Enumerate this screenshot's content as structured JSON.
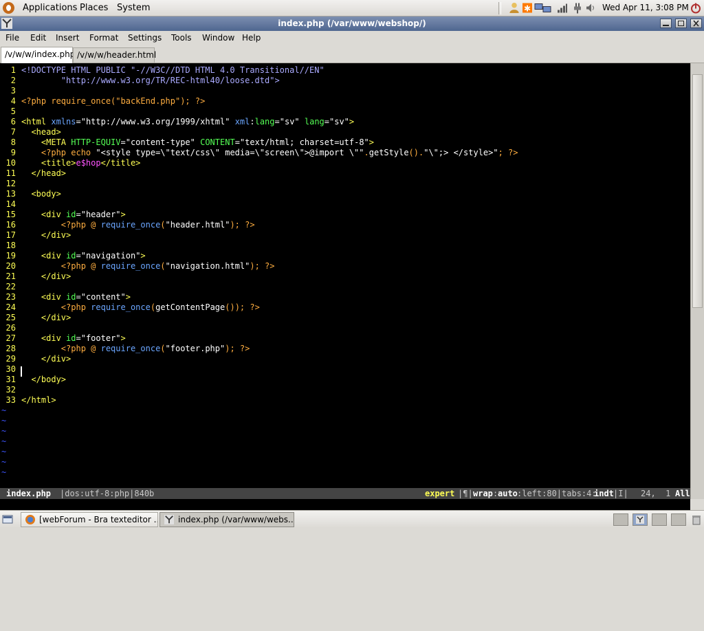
{
  "top_panel": {
    "menus": [
      "Applications",
      "Places",
      "System"
    ],
    "clock": "Wed Apr 11,  3:08 PM"
  },
  "window": {
    "title": "index.php (/var/www/webshop/)"
  },
  "menubar": [
    "File",
    "Edit",
    "Insert",
    "Format",
    "Settings",
    "Tools",
    "Window",
    "Help"
  ],
  "tabs": [
    {
      "label": "/v/w/w/index.php",
      "active": true
    },
    {
      "label": "/v/w/w/header.html",
      "active": false
    }
  ],
  "code_lines": [
    {
      "n": "1",
      "segs": [
        [
          "c-doc",
          "<!DOCTYPE HTML PUBLIC \"-//W3C//DTD HTML 4.0 Transitional//EN\""
        ]
      ]
    },
    {
      "n": "2",
      "segs": [
        [
          "c-doc",
          "        \"http://www.w3.org/TR/REC-html40/loose.dtd\">"
        ]
      ]
    },
    {
      "n": "3",
      "segs": []
    },
    {
      "n": "4",
      "segs": [
        [
          "c-php",
          "<?php require_once(\"backEnd.php\"); ?>"
        ]
      ]
    },
    {
      "n": "5",
      "segs": []
    },
    {
      "n": "6",
      "segs": [
        [
          "c-tag",
          "<html "
        ],
        [
          "c-fn",
          "xmlns"
        ],
        [
          "c-plain",
          "="
        ],
        [
          "c-str",
          "\"http://www.w3.org/1999/xhtml\" "
        ],
        [
          "c-fn",
          "xml"
        ],
        [
          "c-plain",
          ":"
        ],
        [
          "c-attr",
          "lang"
        ],
        [
          "c-plain",
          "="
        ],
        [
          "c-str",
          "\"sv\" "
        ],
        [
          "c-attr",
          "lang"
        ],
        [
          "c-plain",
          "="
        ],
        [
          "c-str",
          "\"sv\""
        ],
        [
          "c-tag",
          ">"
        ]
      ]
    },
    {
      "n": "7",
      "segs": [
        [
          "c-tag",
          "  <head>"
        ]
      ]
    },
    {
      "n": "8",
      "segs": [
        [
          "c-tag",
          "    <META "
        ],
        [
          "c-attr",
          "HTTP-EQUIV"
        ],
        [
          "c-plain",
          "="
        ],
        [
          "c-str",
          "\"content-type\" "
        ],
        [
          "c-attr",
          "CONTENT"
        ],
        [
          "c-plain",
          "="
        ],
        [
          "c-str",
          "\"text/html; charset=utf-8\""
        ],
        [
          "c-tag",
          ">"
        ]
      ]
    },
    {
      "n": "9",
      "segs": [
        [
          "c-php",
          "    <?php echo "
        ],
        [
          "c-str",
          "\"<style type=\\\"text/css\\\" media=\\\"screen\\\">@import \\\"\""
        ],
        [
          "c-php",
          "."
        ],
        [
          "c-str",
          "getStyle"
        ],
        [
          "c-php",
          "()."
        ],
        [
          "c-str",
          "\"\\\";> </style>\""
        ],
        [
          "c-php",
          "; ?>"
        ]
      ]
    },
    {
      "n": "10",
      "segs": [
        [
          "c-tag",
          "    <title>"
        ],
        [
          "c-mag",
          "e$hop"
        ],
        [
          "c-tag",
          "</title>"
        ]
      ]
    },
    {
      "n": "11",
      "segs": [
        [
          "c-tag",
          "  </head>"
        ]
      ]
    },
    {
      "n": "12",
      "segs": []
    },
    {
      "n": "13",
      "segs": [
        [
          "c-tag",
          "  <body>"
        ]
      ]
    },
    {
      "n": "14",
      "segs": []
    },
    {
      "n": "15",
      "segs": [
        [
          "c-tag",
          "    <div "
        ],
        [
          "c-attr",
          "id"
        ],
        [
          "c-plain",
          "="
        ],
        [
          "c-str",
          "\"header\""
        ],
        [
          "c-tag",
          ">"
        ]
      ]
    },
    {
      "n": "16",
      "segs": [
        [
          "c-php",
          "        <?php @ "
        ],
        [
          "c-fn",
          "require_once"
        ],
        [
          "c-php",
          "("
        ],
        [
          "c-str",
          "\"header.html\""
        ],
        [
          "c-php",
          "); ?>"
        ]
      ]
    },
    {
      "n": "17",
      "segs": [
        [
          "c-tag",
          "    </div>"
        ]
      ]
    },
    {
      "n": "18",
      "segs": []
    },
    {
      "n": "19",
      "segs": [
        [
          "c-tag",
          "    <div "
        ],
        [
          "c-attr",
          "id"
        ],
        [
          "c-plain",
          "="
        ],
        [
          "c-str",
          "\"navigation\""
        ],
        [
          "c-tag",
          ">"
        ]
      ]
    },
    {
      "n": "20",
      "segs": [
        [
          "c-php",
          "        <?php @ "
        ],
        [
          "c-fn",
          "require_once"
        ],
        [
          "c-php",
          "("
        ],
        [
          "c-str",
          "\"navigation.html\""
        ],
        [
          "c-php",
          "); ?>"
        ]
      ]
    },
    {
      "n": "21",
      "segs": [
        [
          "c-tag",
          "    </div>"
        ]
      ]
    },
    {
      "n": "22",
      "segs": []
    },
    {
      "n": "23",
      "segs": [
        [
          "c-tag",
          "    <div "
        ],
        [
          "c-attr",
          "id"
        ],
        [
          "c-plain",
          "="
        ],
        [
          "c-str",
          "\"content\""
        ],
        [
          "c-tag",
          ">"
        ]
      ]
    },
    {
      "n": "24",
      "segs": [
        [
          "c-php",
          "        <?php "
        ],
        [
          "c-fn",
          "require_once"
        ],
        [
          "c-php",
          "("
        ],
        [
          "c-str",
          "getContentPage"
        ],
        [
          "c-php",
          "()); ?>"
        ]
      ]
    },
    {
      "n": "25",
      "segs": [
        [
          "c-tag",
          "    </div>"
        ]
      ]
    },
    {
      "n": "26",
      "segs": []
    },
    {
      "n": "27",
      "segs": [
        [
          "c-tag",
          "    <div "
        ],
        [
          "c-attr",
          "id"
        ],
        [
          "c-plain",
          "="
        ],
        [
          "c-str",
          "\"footer\""
        ],
        [
          "c-tag",
          ">"
        ]
      ]
    },
    {
      "n": "28",
      "segs": [
        [
          "c-php",
          "        <?php @ "
        ],
        [
          "c-fn",
          "require_once"
        ],
        [
          "c-php",
          "("
        ],
        [
          "c-str",
          "\"footer.php\""
        ],
        [
          "c-php",
          "); ?>"
        ]
      ]
    },
    {
      "n": "29",
      "segs": [
        [
          "c-tag",
          "    </div>"
        ]
      ]
    },
    {
      "n": "30",
      "segs": []
    },
    {
      "n": "31",
      "segs": [
        [
          "c-tag",
          "  </body>"
        ]
      ]
    },
    {
      "n": "32",
      "segs": []
    },
    {
      "n": "33",
      "segs": [
        [
          "c-tag",
          "</html>"
        ]
      ]
    }
  ],
  "empty_line_marker": "~",
  "empty_line_count": 7,
  "statusline": {
    "filename": "index.php",
    "fileinfo": "|dos:utf-8:php|840b",
    "mode": "expert",
    "flags_pre": "|¶|",
    "wrap": "wrap",
    "wrap_sep": ":",
    "auto": "auto",
    "left": ":left:80|tabs:4:",
    "indt": "indt",
    "tail": "|I|",
    "position": "24,  1",
    "scope": "All"
  },
  "taskbar": [
    {
      "label": "[webForum - Bra texteditor ...",
      "active": false
    },
    {
      "label": "index.php (/var/www/webs...",
      "active": true
    }
  ],
  "colors": {
    "editor_bg": "#000000",
    "line_numbers": "#ffff55",
    "statusline_bg": "#444444",
    "titlebar": "#4f6690"
  }
}
